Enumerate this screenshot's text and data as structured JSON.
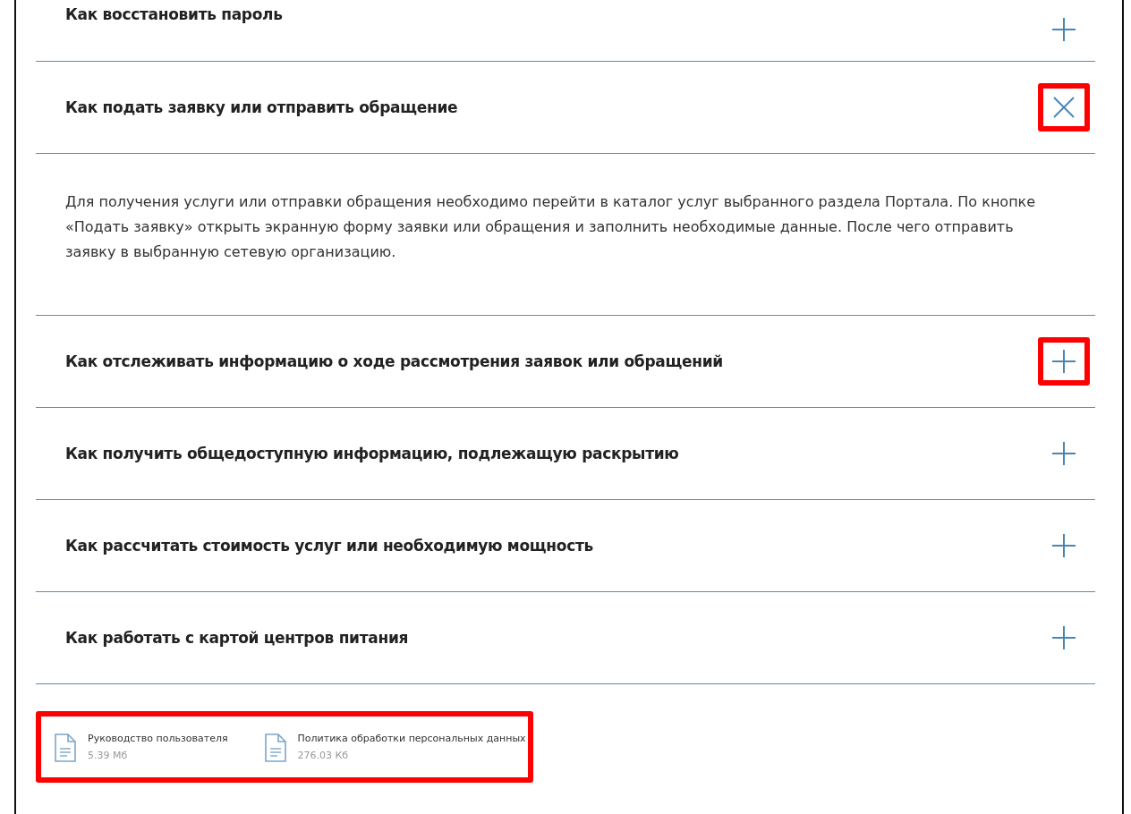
{
  "faq": [
    {
      "question": "Как восстановить пароль",
      "expanded": false,
      "highlighted": false
    },
    {
      "question": "Как подать заявку или отправить обращение",
      "expanded": true,
      "highlighted": true,
      "answer": "Для получения услуги или отправки обращения необходимо перейти в каталог услуг выбранного раздела Портала. По кнопке «Подать заявку» открыть экранную форму заявки или обращения и заполнить необходимые данные. После чего отправить заявку в выбранную сетевую организацию."
    },
    {
      "question": "Как отслеживать информацию о ходе рассмотрения заявок или обращений",
      "expanded": false,
      "highlighted": true
    },
    {
      "question": "Как получить общедоступную информацию, подлежащую раскрытию",
      "expanded": false,
      "highlighted": false
    },
    {
      "question": "Как рассчитать стоимость услуг или необходимую мощность",
      "expanded": false,
      "highlighted": false
    },
    {
      "question": "Как работать с картой центров питания",
      "expanded": false,
      "highlighted": false
    }
  ],
  "files": {
    "highlighted": true,
    "items": [
      {
        "name": "Руководство пользователя",
        "size": "5.39 Мб"
      },
      {
        "name": "Политика обработки персональных данных",
        "size": "276.03 Кб"
      }
    ]
  }
}
